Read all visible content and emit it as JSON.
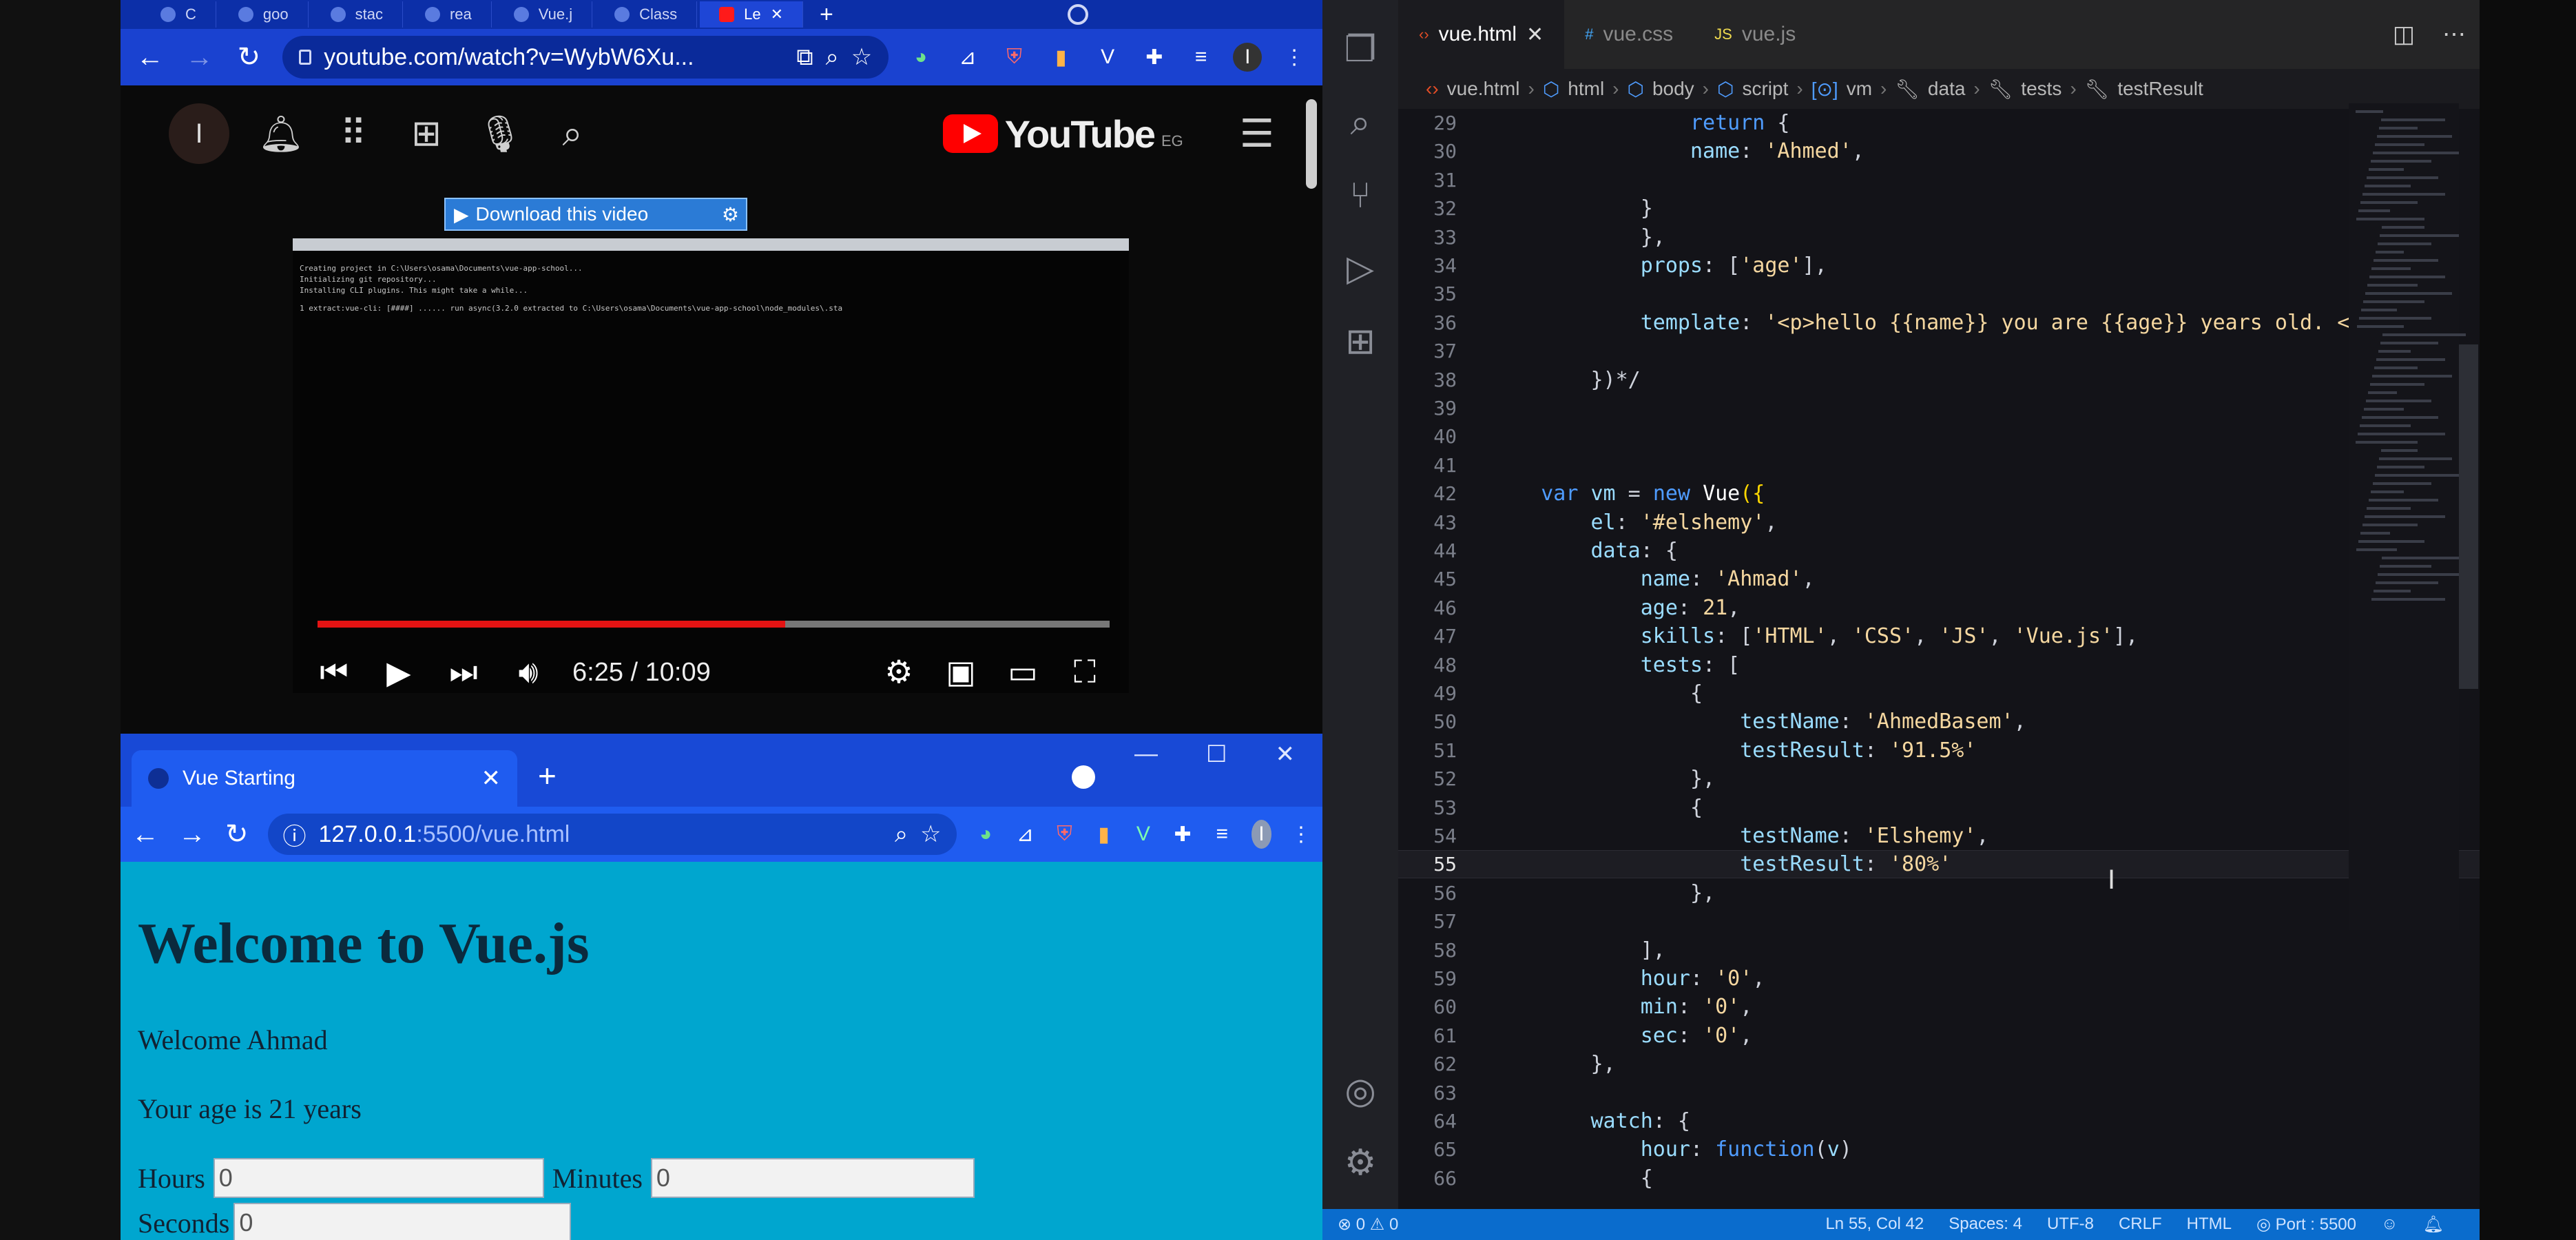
{
  "youtube_browser": {
    "tabs": [
      {
        "label": "C"
      },
      {
        "label": "goo"
      },
      {
        "label": "stac"
      },
      {
        "label": "rea"
      },
      {
        "label": "Vue.j"
      },
      {
        "label": "Class"
      },
      {
        "label": "Le"
      }
    ],
    "address": "youtube.com/watch?v=WybW6Xu...",
    "download_label": "Download this video",
    "logo_text": "YouTube",
    "region": "EG",
    "avatar_letter": "I",
    "terminal_lines": [
      "Creating project in C:\\Users\\osama\\Documents\\vue-app-school...",
      "Initializing git repository...",
      "Installing CLI plugins. This might take a while...",
      "  1 extract:vue-cli: [####] ...... run async(3.2.0 extracted to C:\\Users\\osama\\Documents\\vue-app-school\\node_modules\\.sta"
    ],
    "time_display": "6:25 / 10:09",
    "progress_fraction": 0.59
  },
  "vue_browser": {
    "tab_title": "Vue Starting",
    "address_host": "127.0.0.1",
    "address_path": ":5500/vue.html",
    "heading": "Welcome to Vue.js",
    "welcome": "Welcome Ahmad",
    "age_text": "Your age is 21 years",
    "hours_label": "Hours",
    "hours_value": "0",
    "minutes_label": "Minutes",
    "minutes_value": "0",
    "seconds_label": "Seconds",
    "seconds_value": "0"
  },
  "vscode": {
    "tabs": [
      {
        "label": "vue.html",
        "icon": "<>"
      },
      {
        "label": "vue.css",
        "icon": "#"
      },
      {
        "label": "vue.js",
        "icon": "JS"
      }
    ],
    "breadcrumbs": [
      "vue.html",
      "html",
      "body",
      "script",
      "vm",
      "data",
      "tests",
      "testResult"
    ],
    "code_lines": [
      {
        "n": "29",
        "html": "                <span class=\"k\">return</span> {"
      },
      {
        "n": "30",
        "html": "                <span class=\"p\">name</span>: <span class=\"s\">'Ahmed'</span>,"
      },
      {
        "n": "31",
        "html": ""
      },
      {
        "n": "32",
        "html": "            }"
      },
      {
        "n": "33",
        "html": "            },"
      },
      {
        "n": "34",
        "html": "            <span class=\"p\">props</span>: [<span class=\"s\">'age'</span>],"
      },
      {
        "n": "35",
        "html": ""
      },
      {
        "n": "36",
        "html": "            <span class=\"p\">template</span>: <span class=\"s\">'&lt;p&gt;hello {{name}} you are {{age}} years old. &lt;/</span>"
      },
      {
        "n": "37",
        "html": ""
      },
      {
        "n": "38",
        "html": "        })*/"
      },
      {
        "n": "39",
        "html": ""
      },
      {
        "n": "40",
        "html": ""
      },
      {
        "n": "41",
        "html": ""
      },
      {
        "n": "42",
        "html": "    <span class=\"k\">var</span> <span class=\"p\">vm</span> = <span class=\"k\">new</span> <span class=\"w\">Vue</span><span class=\"fb\">({</span>"
      },
      {
        "n": "43",
        "html": "        <span class=\"p\">el</span>: <span class=\"s\">'#elshemy'</span>,"
      },
      {
        "n": "44",
        "html": "        <span class=\"p\">data</span>: {"
      },
      {
        "n": "45",
        "html": "            <span class=\"p\">name</span>: <span class=\"s\">'Ahmad'</span>,"
      },
      {
        "n": "46",
        "html": "            <span class=\"p\">age</span>: <span class=\"s\">21</span>,"
      },
      {
        "n": "47",
        "html": "            <span class=\"p\">skills</span>: [<span class=\"s\">'HTML'</span>, <span class=\"s\">'CSS'</span>, <span class=\"s\">'JS'</span>, <span class=\"s\">'Vue.js'</span>],"
      },
      {
        "n": "48",
        "html": "            <span class=\"p\">tests</span>: ["
      },
      {
        "n": "49",
        "html": "                {"
      },
      {
        "n": "50",
        "html": "                    <span class=\"p\">testName</span>: <span class=\"s\">'AhmedBasem'</span>,"
      },
      {
        "n": "51",
        "html": "                    <span class=\"p\">testResult</span>: <span class=\"s\">'91.5%'</span>"
      },
      {
        "n": "52",
        "html": "                },"
      },
      {
        "n": "53",
        "html": "                {"
      },
      {
        "n": "54",
        "html": "                    <span class=\"p\">testName</span>: <span class=\"s\">'Elshemy'</span>,"
      },
      {
        "n": "55",
        "html": "                    <span class=\"p\">testResult</span>: <span class=\"s\">'80%'</span>",
        "current": true
      },
      {
        "n": "56",
        "html": "                },"
      },
      {
        "n": "57",
        "html": ""
      },
      {
        "n": "58",
        "html": "            ],"
      },
      {
        "n": "59",
        "html": "            <span class=\"p\">hour</span>: <span class=\"s\">'0'</span>,"
      },
      {
        "n": "60",
        "html": "            <span class=\"p\">min</span>: <span class=\"s\">'0'</span>,"
      },
      {
        "n": "61",
        "html": "            <span class=\"p\">sec</span>: <span class=\"s\">'0'</span>,"
      },
      {
        "n": "62",
        "html": "        },"
      },
      {
        "n": "63",
        "html": ""
      },
      {
        "n": "64",
        "html": "        <span class=\"p\">watch</span>: {"
      },
      {
        "n": "65",
        "html": "            <span class=\"p\">hour</span>: <span class=\"k\">function</span>(<span class=\"p\">v</span>)"
      },
      {
        "n": "66",
        "html": "            {"
      }
    ],
    "status": {
      "problems": "⊗ 0 ⚠ 0",
      "position": "Ln 55, Col 42",
      "spaces": "Spaces: 4",
      "encoding": "UTF-8",
      "eol": "CRLF",
      "language": "HTML",
      "port": "◎ Port : 5500"
    },
    "accent_color": "#0a6ccd"
  }
}
